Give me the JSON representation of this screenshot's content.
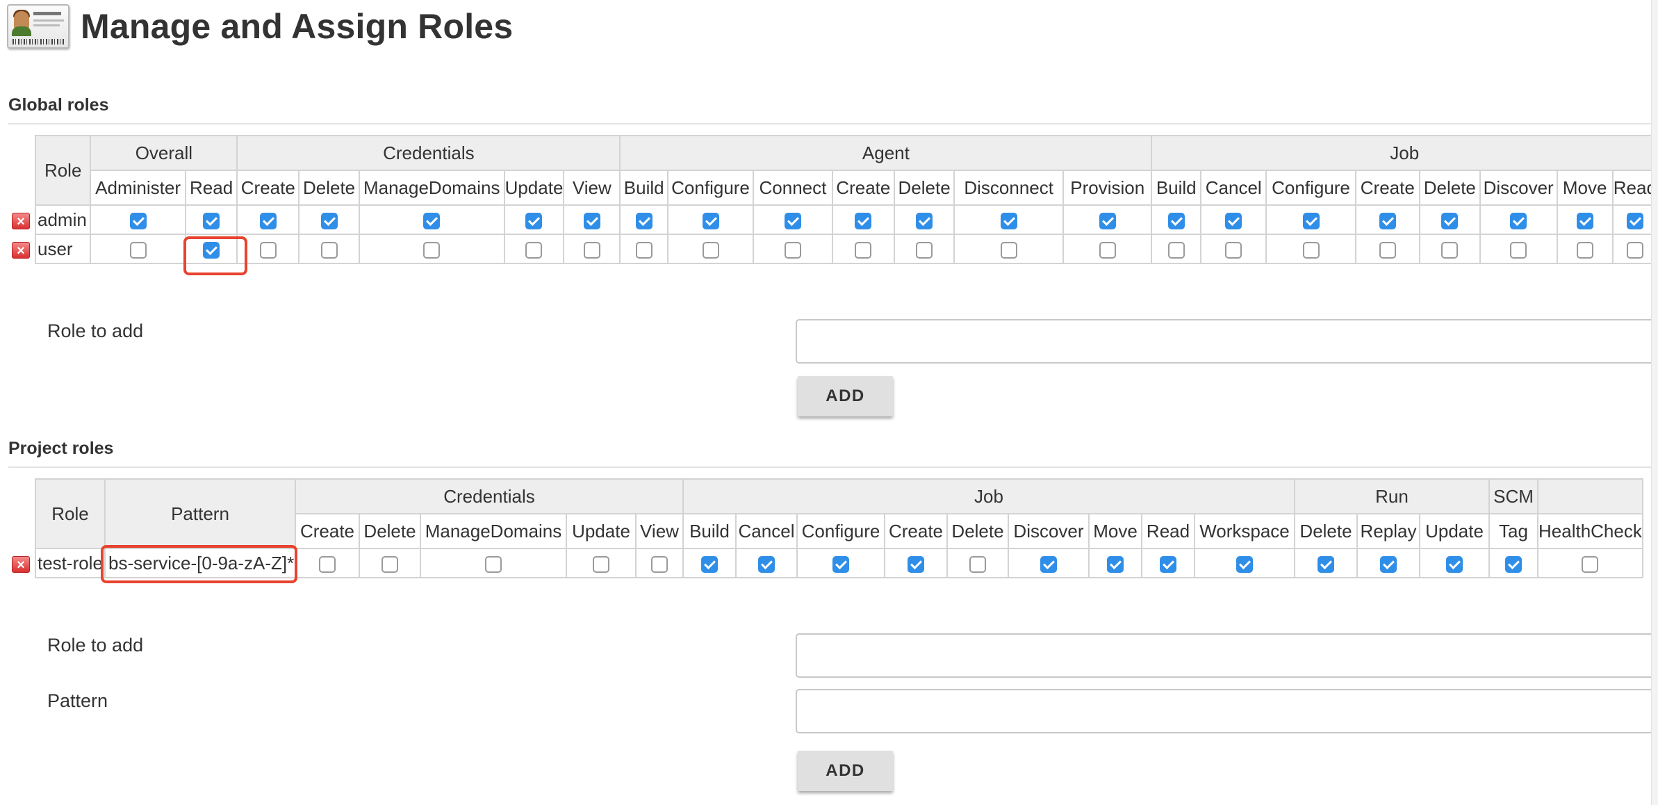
{
  "page": {
    "title": "Manage and Assign Roles"
  },
  "global_roles": {
    "title": "Global roles",
    "role_header": "Role",
    "groups": [
      {
        "label": "Overall",
        "perms": [
          "Administer",
          "Read"
        ]
      },
      {
        "label": "Credentials",
        "perms": [
          "Create",
          "Delete",
          "ManageDomains",
          "Update",
          "View"
        ]
      },
      {
        "label": "Agent",
        "perms": [
          "Build",
          "Configure",
          "Connect",
          "Create",
          "Delete",
          "Disconnect",
          "Provision"
        ]
      },
      {
        "label": "Job",
        "perms": [
          "Build",
          "Cancel",
          "Configure",
          "Create",
          "Delete",
          "Discover",
          "Move",
          "Read"
        ]
      }
    ],
    "rows": [
      {
        "name": "admin",
        "checks": [
          true,
          true,
          true,
          true,
          true,
          true,
          true,
          true,
          true,
          true,
          true,
          true,
          true,
          true,
          true,
          true,
          true,
          true,
          true,
          true,
          true,
          true
        ]
      },
      {
        "name": "user",
        "checks": [
          false,
          true,
          false,
          false,
          false,
          false,
          false,
          false,
          false,
          false,
          false,
          false,
          false,
          false,
          false,
          false,
          false,
          false,
          false,
          false,
          false,
          false
        ]
      }
    ],
    "role_to_add_label": "Role to add",
    "add_button": "ADD"
  },
  "project_roles": {
    "title": "Project roles",
    "role_header": "Role",
    "pattern_header": "Pattern",
    "groups": [
      {
        "label": "Credentials",
        "perms": [
          "Create",
          "Delete",
          "ManageDomains",
          "Update",
          "View"
        ]
      },
      {
        "label": "Job",
        "perms": [
          "Build",
          "Cancel",
          "Configure",
          "Create",
          "Delete",
          "Discover",
          "Move",
          "Read",
          "Workspace"
        ]
      },
      {
        "label": "Run",
        "perms": [
          "Delete",
          "Replay",
          "Update"
        ]
      },
      {
        "label": "SCM",
        "perms": [
          "Tag"
        ]
      },
      {
        "label": "",
        "perms": [
          "HealthCheck"
        ]
      }
    ],
    "rows": [
      {
        "name": "test-role",
        "pattern": "bs-service-[0-9a-zA-Z]*",
        "checks": [
          false,
          false,
          false,
          false,
          false,
          true,
          true,
          true,
          true,
          false,
          true,
          true,
          true,
          true,
          true,
          true,
          true,
          true,
          false
        ]
      }
    ],
    "role_to_add_label": "Role to add",
    "pattern_label": "Pattern",
    "add_button": "ADD"
  },
  "colors": {
    "checkbox_checked": "#2f8ee8",
    "highlight": "#e8432f",
    "delete_icon": "#d93030"
  }
}
